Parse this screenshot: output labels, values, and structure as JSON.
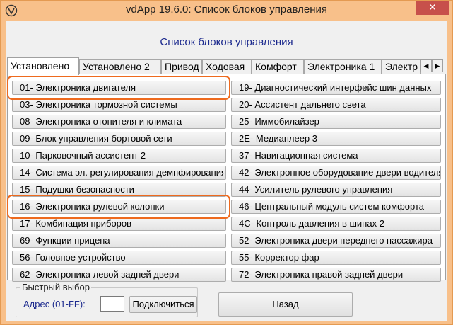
{
  "window": {
    "title": "vdApp 19.6.0:  Список блоков управления",
    "close_label": "✕"
  },
  "header": {
    "title": "Список блоков управления"
  },
  "tabs": [
    {
      "label": "Установлено",
      "active": true
    },
    {
      "label": "Установлено 2",
      "active": false
    },
    {
      "label": "Привод",
      "active": false
    },
    {
      "label": "Ходовая",
      "active": false
    },
    {
      "label": "Комфорт",
      "active": false
    },
    {
      "label": "Электроника 1",
      "active": false
    },
    {
      "label": "Электр",
      "active": false
    }
  ],
  "tab_scroll": {
    "left": "◀",
    "right": "▶"
  },
  "modules_left": [
    "01- Электроника двигателя",
    "03- Электроника тормозной системы",
    "08- Электроника отопителя и климата",
    "09- Блок управления бортовой сети",
    "10- Парковочный ассистент 2",
    "14- Система эл. регулирования демпфирования",
    "15- Подушки безопасности",
    "16- Электроника рулевой колонки",
    "17- Комбинация приборов",
    "69- Функции прицепа",
    "56- Головное устройство",
    "62- Электроника левой задней двери"
  ],
  "modules_right": [
    "19- Диагностический интерфейс шин данных",
    "20- Ассистент дальнего света",
    "25- Иммобилайзер",
    "2E- Медиаплеер 3",
    "37- Навигационная система",
    "42- Электронное оборудование двери водителя",
    "44- Усилитель рулевого управления",
    "46- Центральный модуль систем комфорта",
    "4C- Контроль давления в шинах 2",
    "52- Электроника двери переднего пассажира",
    "55- Корректор фар",
    "72- Электроника правой задней двери"
  ],
  "quick_select": {
    "title": "Быстрый выбор",
    "address_label": "Адрес (01-FF):",
    "address_value": "",
    "connect_label": "Подключиться"
  },
  "back_label": "Назад",
  "colors": {
    "titlebar": "#f8c08a",
    "close": "#c7504b",
    "highlight": "#ee6a1e",
    "header_text": "#1c2a8e"
  }
}
